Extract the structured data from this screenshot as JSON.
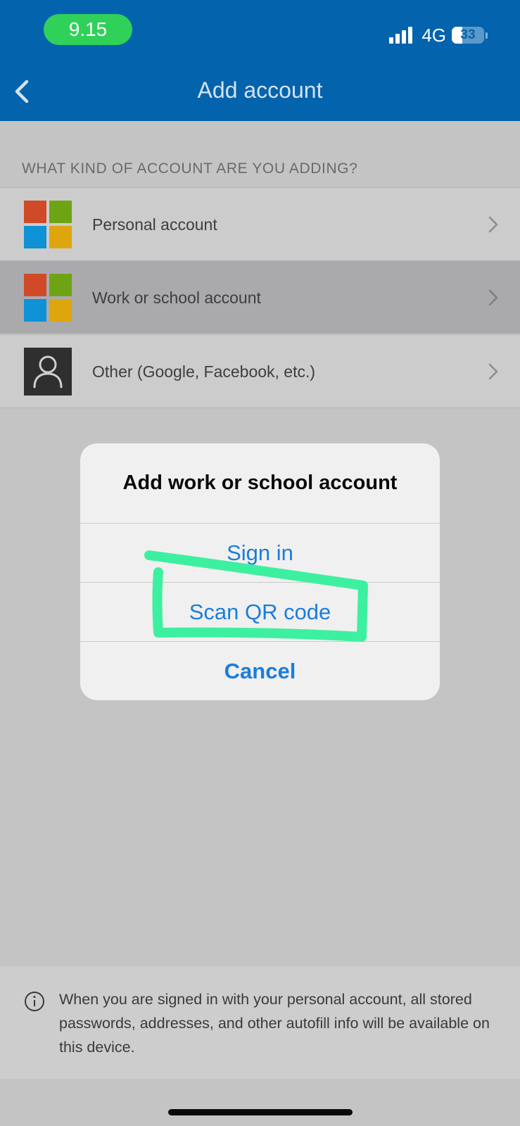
{
  "status_bar": {
    "time": "9.15",
    "network": "4G",
    "battery_percent": "33",
    "battery_level": 0.33,
    "signal_bars": 4
  },
  "nav": {
    "title": "Add account",
    "back_icon": "chevron-left-icon"
  },
  "section": {
    "header": "WHAT KIND OF ACCOUNT ARE YOU ADDING?"
  },
  "accounts": [
    {
      "label": "Personal account",
      "icon": "microsoft-logo-icon"
    },
    {
      "label": "Work or school account",
      "icon": "microsoft-logo-icon",
      "selected": true
    },
    {
      "label": "Other (Google, Facebook, etc.)",
      "icon": "person-icon"
    }
  ],
  "dialog": {
    "title": "Add work or school account",
    "sign_in": "Sign in",
    "scan_qr": "Scan QR code",
    "cancel": "Cancel"
  },
  "info": {
    "text": "When you are signed in with your personal account, all stored passwords, addresses, and other autofill info will be available on this device."
  },
  "colors": {
    "header_blue": "#0363ad",
    "action_blue": "#1b7ddb",
    "annotation_green": "#3df0a0",
    "ms_red": "#d04a27",
    "ms_green": "#6ea413",
    "ms_blue": "#0f91d6",
    "ms_yellow": "#dea60d"
  }
}
